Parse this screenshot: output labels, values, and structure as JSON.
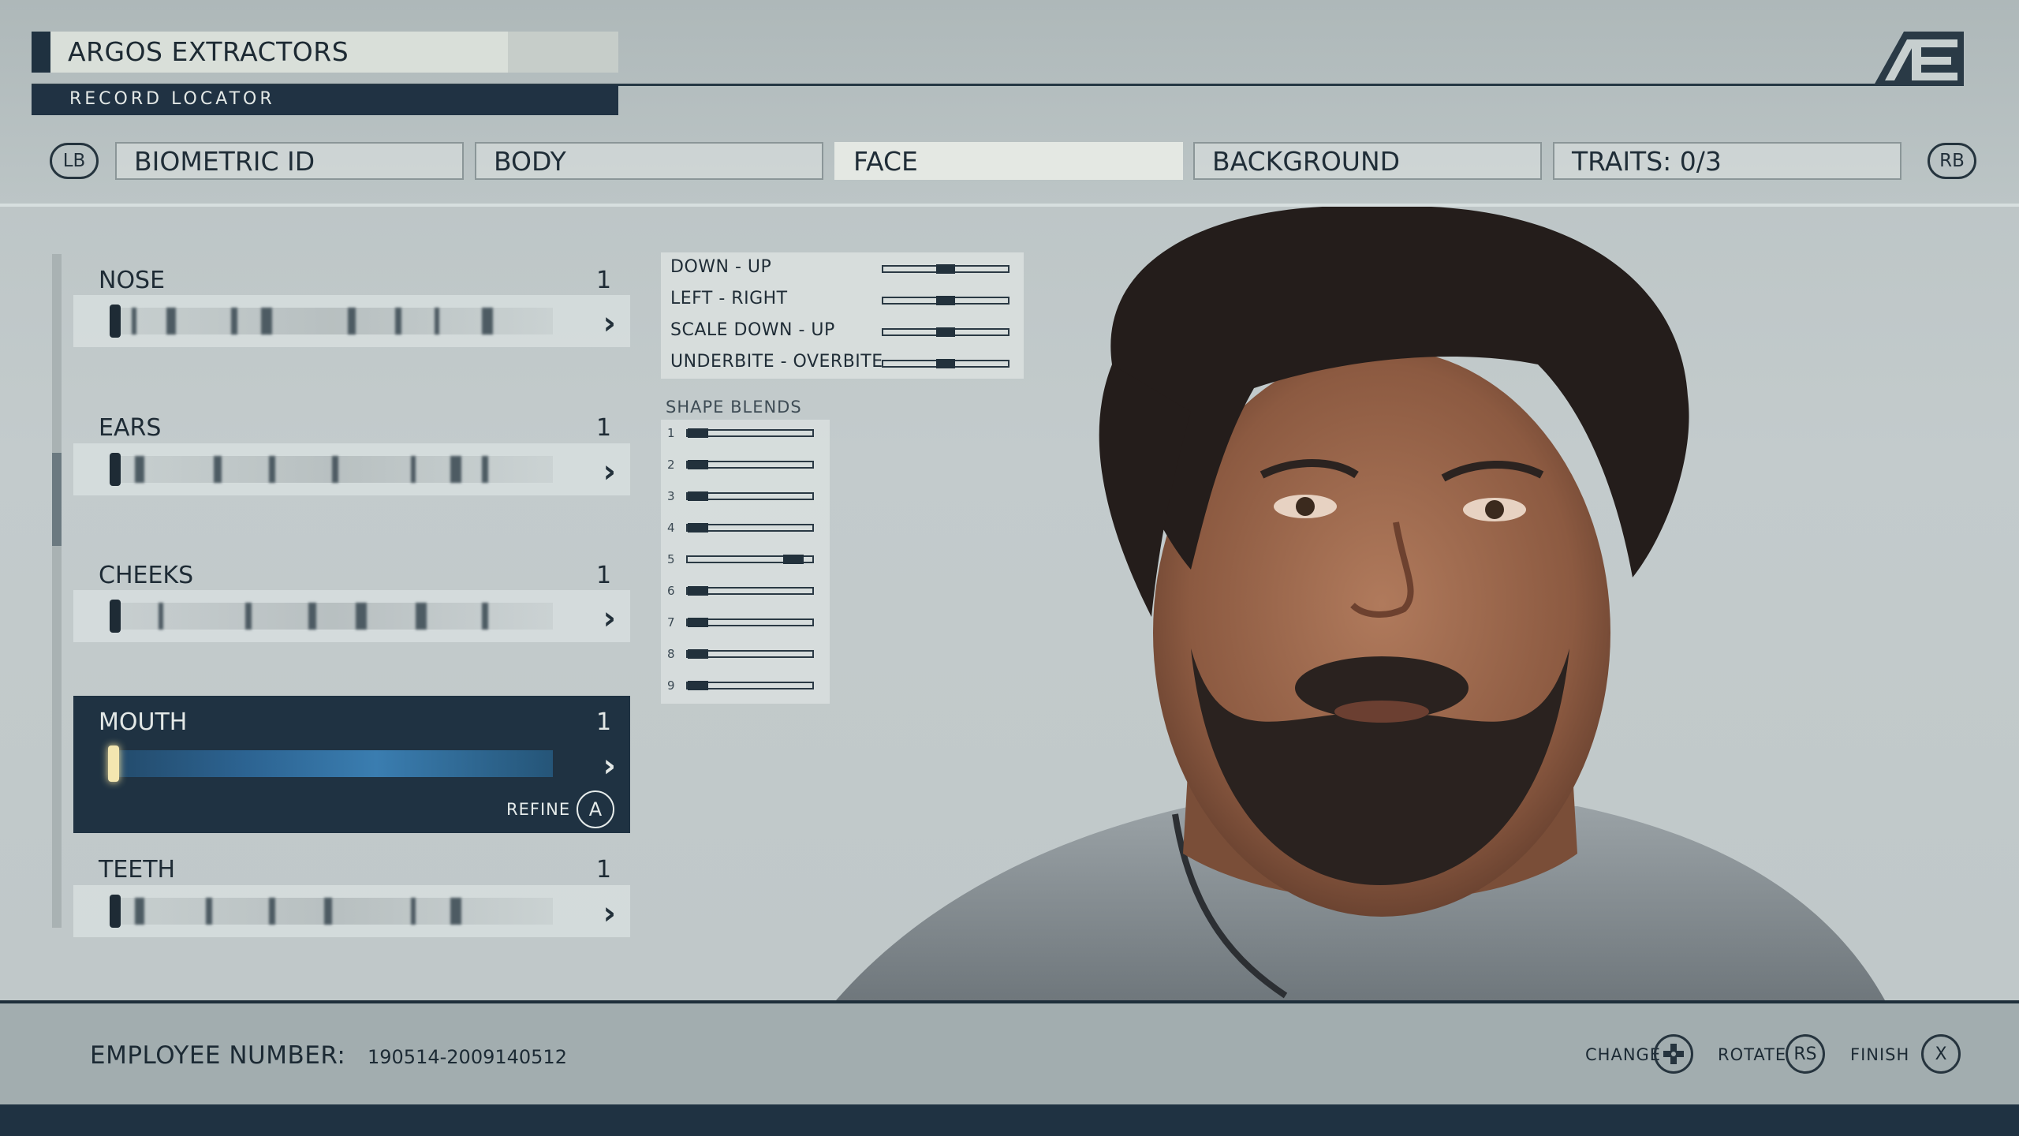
{
  "header": {
    "company": "ARGOS EXTRACTORS",
    "record_label": "RECORD LOCATOR"
  },
  "tabs": {
    "left_bumper": "LB",
    "right_bumper": "RB",
    "items": [
      {
        "label": "BIOMETRIC ID",
        "active": false
      },
      {
        "label": "BODY",
        "active": false
      },
      {
        "label": "FACE",
        "active": true
      },
      {
        "label": "BACKGROUND",
        "active": false
      },
      {
        "label": "TRAITS: 0/3",
        "active": false
      }
    ]
  },
  "features": [
    {
      "label": "NOSE",
      "count": "1",
      "selected": false
    },
    {
      "label": "EARS",
      "count": "1",
      "selected": false
    },
    {
      "label": "CHEEKS",
      "count": "1",
      "selected": false
    },
    {
      "label": "MOUTH",
      "count": "1",
      "selected": true
    },
    {
      "label": "TEETH",
      "count": "1",
      "selected": false
    }
  ],
  "refine": {
    "label": "REFINE",
    "button": "A"
  },
  "sliders": [
    {
      "label": "DOWN - UP",
      "value": 0.5
    },
    {
      "label": "LEFT - RIGHT",
      "value": 0.5
    },
    {
      "label": "SCALE DOWN - UP",
      "value": 0.5
    },
    {
      "label": "UNDERBITE - OVERBITE",
      "value": 0.5
    }
  ],
  "shape_blends": {
    "title": "SHAPE BLENDS",
    "items": [
      {
        "label": "1",
        "value": 0.0
      },
      {
        "label": "2",
        "value": 0.0
      },
      {
        "label": "3",
        "value": 0.0
      },
      {
        "label": "4",
        "value": 0.0
      },
      {
        "label": "5",
        "value": 0.92
      },
      {
        "label": "6",
        "value": 0.0
      },
      {
        "label": "7",
        "value": 0.0
      },
      {
        "label": "8",
        "value": 0.0
      },
      {
        "label": "9",
        "value": 0.0
      }
    ]
  },
  "footer": {
    "employee_label": "EMPLOYEE NUMBER:",
    "employee_number": "190514-2009140512",
    "change_label": "CHANGE",
    "rotate_label": "ROTATE",
    "rotate_button": "RS",
    "finish_label": "FINISH",
    "finish_button": "X"
  },
  "colors": {
    "panel_dark": "#1f3242",
    "accent_text": "#1d2a33",
    "background": "#c3cbcc"
  }
}
